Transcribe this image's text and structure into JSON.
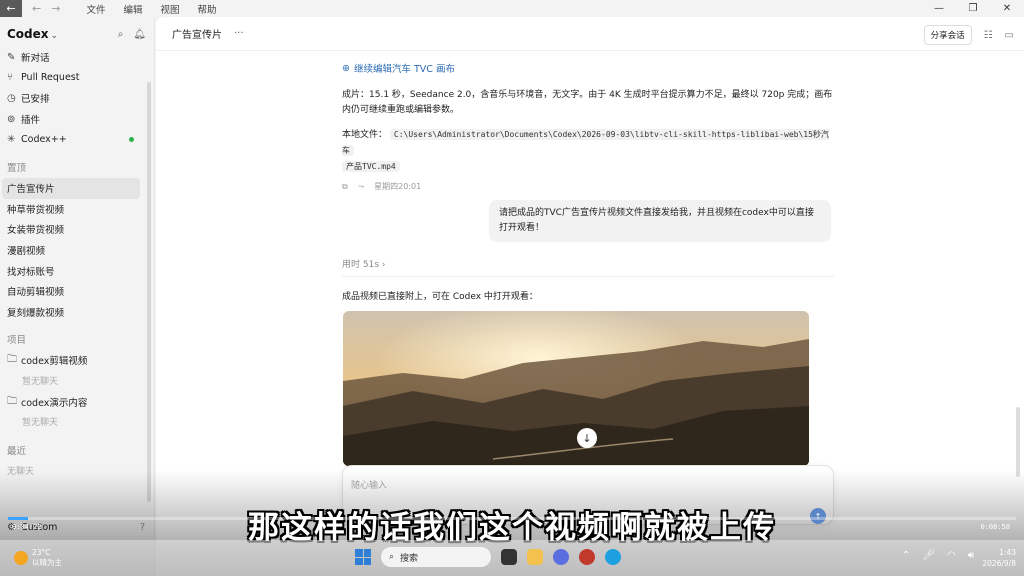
{
  "titlebar": {
    "menu": [
      "文件",
      "编辑",
      "视图",
      "帮助"
    ]
  },
  "sidebar": {
    "brand": "Codex",
    "top_items": [
      {
        "label": "新对话"
      },
      {
        "label": "Pull Request"
      },
      {
        "label": "已安排"
      },
      {
        "label": "插件"
      },
      {
        "label": "Codex++"
      }
    ],
    "pinned_section": "置顶",
    "pinned_items": [
      "广告宣传片",
      "种草带货视频",
      "女装带货视频",
      "漫剧视频",
      "找对标账号",
      "自动剪辑视频",
      "复刻爆款视频"
    ],
    "projects_section": "项目",
    "projects": [
      {
        "label": "codex剪辑视频",
        "empty": "暂无聊天"
      },
      {
        "label": "codex演示内容",
        "empty": "暂无聊天"
      }
    ],
    "recent_section": "最近",
    "recent_empty": "无聊天",
    "bottom_item": "Custom"
  },
  "main": {
    "title": "广告宣传片",
    "more": "···",
    "share_label": "分享会话",
    "link_text": "继续编辑汽车 TVC 画布",
    "paragraph": "成片：15.1 秒，Seedance 2.0，含音乐与环境音，无文字。由于 4K 生成时平台提示算力不足，最终以 720p 完成；画布内仍可继续重跑或编辑参数。",
    "local_file_label": "本地文件：",
    "local_file_path_1": "C:\\Users\\Administrator\\Documents\\Codex\\2026-09-03\\libtv-cli-skill-https-liblibai-web\\15秒汽车",
    "local_file_path_2": "产品TVC.mp4",
    "timestamp": "星期四20:01",
    "user_message": "请把成品的TVC广告宣传片视频文件直接发给我，并且视频在codex中可以直接打开观看！",
    "elapsed": "用时 51s",
    "elapsed_chevron": "›",
    "result_text": "成品视频已直接附上，可在 Codex 中打开观看：",
    "composer_placeholder": "随心输入"
  },
  "overlay": {
    "subtitle": "那这样的话我们这个视频啊就被上传",
    "time_left": "0:04:72",
    "time_right": "0:00:58",
    "progress_fraction": 0.02
  },
  "taskbar": {
    "temperature": "23°C",
    "weather_text": "以晴为主",
    "search_label": "搜索",
    "time": "1:43",
    "date": "2026/9/8"
  },
  "colors": {
    "accent_link": "#2d6db5",
    "status_green": "#2bb34a",
    "progress_blue": "#3aa3ff"
  }
}
